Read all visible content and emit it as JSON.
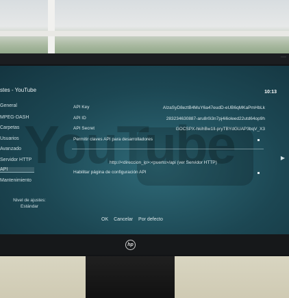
{
  "screen": {
    "title": "stes - YouTube",
    "clock": "10:13",
    "categories": [
      "General",
      "MPEG-DASH",
      "Carpetas",
      "Usuarios",
      "Avanzado",
      "Servidor HTTP",
      "API",
      "Mantenimiento"
    ],
    "active_category_index": 6,
    "settings": [
      {
        "label": "API Key",
        "value": "AIzaSyD8eztB4MuY6a47eudD-eUB6qMKaPmHbLk"
      },
      {
        "label": "API ID",
        "value": "283234630887-aru8r0i3n7pj4i6oleed22utd64op9h"
      },
      {
        "label": "API Secret",
        "value": "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"
      }
    ],
    "allow_dev_keys_label": "Permitir claves API para desarrolladores",
    "api_url_hint": "http://<direccion_ip>:<puerto>/api (ver Servidor HTTP)",
    "enable_config_page_label": "Habilitar página de configuración API",
    "level_label": "Nivel de ajustes:",
    "level_value": "Estándar",
    "buttons": {
      "ok": "OK",
      "cancel": "Cancelar",
      "default": "Por defecto"
    },
    "watermark": "YouTube"
  },
  "monitor": {
    "brand_logo": "hp"
  }
}
